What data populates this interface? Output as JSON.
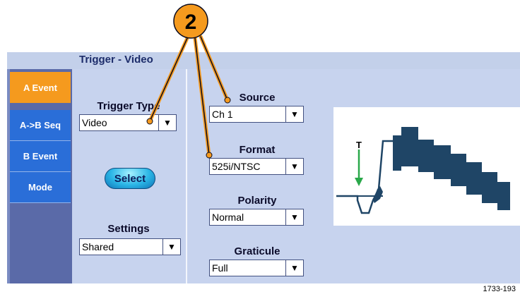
{
  "window": {
    "title": "Trigger - Video"
  },
  "callout": {
    "number": "2"
  },
  "menu": {
    "items": [
      {
        "label": "A Event",
        "active": true
      },
      {
        "label": "A->B Seq",
        "active": false
      },
      {
        "label": "B Event",
        "active": false
      },
      {
        "label": "Mode",
        "active": false
      }
    ]
  },
  "trigger_type": {
    "label": "Trigger Type",
    "value": "Video"
  },
  "select_button": {
    "label": "Select"
  },
  "settings": {
    "label": "Settings",
    "value": "Shared"
  },
  "source": {
    "label": "Source",
    "value": "Ch 1"
  },
  "format": {
    "label": "Format",
    "value": "525i/NTSC"
  },
  "polarity": {
    "label": "Polarity",
    "value": "Normal"
  },
  "graticule": {
    "label": "Graticule",
    "value": "Full"
  },
  "waveform": {
    "trigger_marker": "T"
  },
  "dropdown_arrow": "▼",
  "figure_id": "1733-193",
  "colors": {
    "accent_orange": "#f59a1e",
    "menu_blue": "#2a6ed8",
    "panel_bg": "#c7d3ee",
    "waveform_fill": "#1f4566",
    "trigger_green": "#2aa84a"
  }
}
